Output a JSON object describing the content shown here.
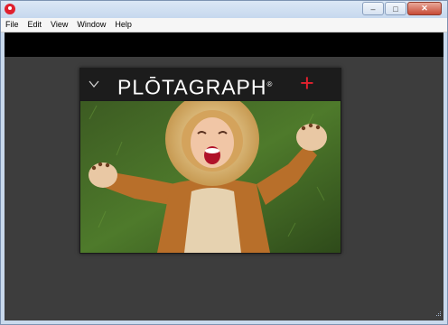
{
  "window": {
    "controls": {
      "minimize": "‒",
      "maximize": "□",
      "close": "✕"
    }
  },
  "menu": [
    "File",
    "Edit",
    "View",
    "Window",
    "Help"
  ],
  "brand": {
    "name": "PLŌTAGRAPH",
    "registered": "®",
    "plus": "+"
  },
  "colors": {
    "accent": "#e5222e",
    "canvas": "#3d3d3d",
    "toolbar": "#000000"
  },
  "icons": {
    "app": "plotagraph-app-icon",
    "collapse": "chevron-down-icon"
  }
}
